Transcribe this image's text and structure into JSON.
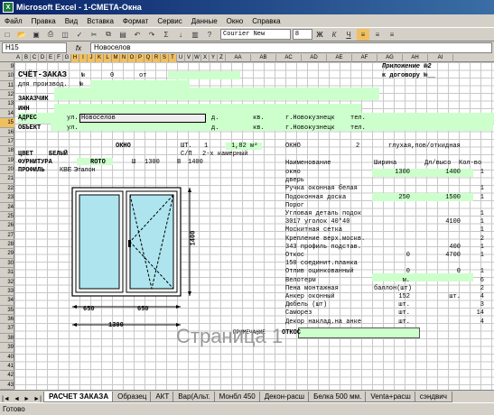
{
  "window": {
    "title": "Microsoft Excel - 1-СМЕТА-Окна"
  },
  "menu": [
    "Файл",
    "Правка",
    "Вид",
    "Вставка",
    "Формат",
    "Сервис",
    "Данные",
    "Окно",
    "Справка"
  ],
  "toolbar": {
    "font": "Courier New",
    "size": "8",
    "bold": "Ж",
    "italic": "К",
    "underline": "Ч"
  },
  "formula_bar": {
    "cell_ref": "H15",
    "fx": "fx",
    "content": "Новоселов"
  },
  "columns": [
    "A",
    "B",
    "C",
    "D",
    "E",
    "F",
    "G",
    "H",
    "I",
    "J",
    "K",
    "L",
    "M",
    "N",
    "O",
    "P",
    "Q",
    "R",
    "S",
    "T",
    "U",
    "V",
    "W",
    "X",
    "Y",
    "Z",
    "AA",
    "AB",
    "AC",
    "AD",
    "AE",
    "AF",
    "AG",
    "AH",
    "AI"
  ],
  "rows": [
    "9",
    "10",
    "11",
    "12",
    "13",
    "14",
    "15",
    "16",
    "17",
    "18",
    "19",
    "20",
    "21",
    "22",
    "23",
    "24",
    "25",
    "26",
    "27",
    "28",
    "29",
    "30",
    "31",
    "32",
    "33",
    "34",
    "35",
    "36",
    "37",
    "38",
    "39",
    "40",
    "41",
    "42",
    "43"
  ],
  "sheet": {
    "appendix": "Приложение №2",
    "contract": "к договору №__",
    "order_title": "СЧЁТ-ЗАКАЗ",
    "no_label": "№",
    "order_no": "0",
    "from": "от",
    "for_production": "для производ.",
    "production_no": "№",
    "customer": "ЗАКАЗЧИК",
    "inn": "ИНН",
    "address": "АДРЕС",
    "street": "ул.",
    "street_value": "Новоселов",
    "house": "д.",
    "flat": "кв.",
    "city": "г.Новокузнецк",
    "phone": "тел.",
    "object": "ОБЪЕКТ",
    "window": "ОКНО",
    "pcs": "ШТ.",
    "qty": "1",
    "area": "1,82 м²",
    "color": "ЦВЕТ",
    "white": "БЕЛЫЙ",
    "glazing": "С/П",
    "glazing_type": "2-х камерный",
    "hardware": "ФУРНИТУРА",
    "hardware_value": "ROTO",
    "w_label": "Ш",
    "width_val": "1300",
    "h_label": "В",
    "height_val": "1400",
    "profile": "ПРОФИЛЬ",
    "profile_value": "КВЕ Эталон",
    "dim_650a": "650",
    "dim_650b": "650",
    "dim_1300": "1300",
    "dim_1400": "1400",
    "note": "ПРИМЕЧАНИЕ",
    "slopes": "ОТКОС",
    "watermark": "Страница 1",
    "right_window": "ОКНО",
    "right_two": "2",
    "right_blind": "глухая,пов/откидная",
    "table_headers": {
      "name": "Наименование",
      "width": "Ширина",
      "length": "Дл/высо",
      "count": "Кол-во"
    },
    "table_rows": [
      {
        "name": "окно",
        "width": "1300",
        "length": "1400",
        "count": "1"
      },
      {
        "name": "дверь",
        "width": "",
        "length": "",
        "count": ""
      },
      {
        "name": "Ручка оконная белая",
        "width": "",
        "length": "",
        "count": "1"
      },
      {
        "name": "Подоконная доска",
        "width": "250",
        "length": "1500",
        "count": "1"
      },
      {
        "name": "Порог",
        "width": "",
        "length": "",
        "count": ""
      },
      {
        "name": "Угловая деталь подок",
        "width": "",
        "length": "",
        "count": "1"
      },
      {
        "name": "3017 уголок 40*40",
        "width": "",
        "length": "4100",
        "count": "1"
      },
      {
        "name": "Москитная сетка",
        "width": "",
        "length": "",
        "count": "1"
      },
      {
        "name": "Крепление верх.москв.",
        "width": "",
        "length": "",
        "count": "2"
      },
      {
        "name": "343 профиль подстав.",
        "width": "",
        "length": "400",
        "count": "1"
      },
      {
        "name": "Откос",
        "width": "0",
        "length": "4700",
        "count": "1"
      },
      {
        "name": "150 соединит.планка",
        "width": "",
        "length": "",
        "count": ""
      },
      {
        "name": "Отлив оцинкованный",
        "width": "0",
        "length": "0",
        "count": "1"
      },
      {
        "name": "Велотерм",
        "width": "м.",
        "length": "",
        "count": "6"
      },
      {
        "name": "Пена монтажная",
        "width": "баллон(шт)",
        "length": "",
        "count": "2"
      },
      {
        "name": "Анкер оконный",
        "width": "152",
        "length": "шт.",
        "count": "4"
      },
      {
        "name": "Дюбель (шт)",
        "width": "шт.",
        "length": "",
        "count": "3"
      },
      {
        "name": "Саморез",
        "width": "шт.",
        "length": "",
        "count": "14"
      },
      {
        "name": "Декор наклад.на анке",
        "width": "шт.",
        "length": "",
        "count": "4"
      }
    ]
  },
  "tabs": [
    "РАСЧЕТ ЗАКАЗА",
    "Образец",
    "АКТ",
    "Вар(Альт.",
    "Монбл 450",
    "Декон-расш",
    "Белка 500 мм.",
    "Venta+расш",
    "сэндвич"
  ],
  "nav": [
    "|◄",
    "◄",
    "►",
    "►|"
  ],
  "status": "Готово"
}
